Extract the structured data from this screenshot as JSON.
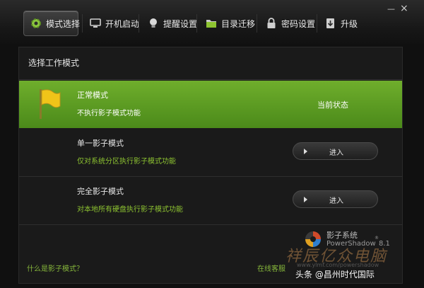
{
  "tabs": [
    {
      "label": "模式选择",
      "icon": "gear-icon"
    },
    {
      "label": "开机启动",
      "icon": "monitor-icon"
    },
    {
      "label": "提醒设置",
      "icon": "lightbulb-icon"
    },
    {
      "label": "目录迁移",
      "icon": "folder-icon"
    },
    {
      "label": "密码设置",
      "icon": "lock-icon"
    },
    {
      "label": "升级",
      "icon": "upgrade-icon"
    }
  ],
  "window_controls": {
    "minimize": "—",
    "close": "×"
  },
  "panel": {
    "title": "选择工作模式",
    "modes": [
      {
        "name": "正常模式",
        "desc": "不执行影子模式功能",
        "status": "当前状态"
      },
      {
        "name": "单一影子模式",
        "desc": "仅对系统分区执行影子模式功能",
        "button": "进入"
      },
      {
        "name": "完全影子模式",
        "desc": "对本地所有硬盘执行影子模式功能",
        "button": "进入"
      }
    ]
  },
  "logo": {
    "name": "影子系统",
    "product": "PowerShadow",
    "version": "8.1"
  },
  "footer": {
    "help_link": "什么是影子模式？",
    "service_link": "在线客服",
    "url": "www.ylmf.com/powershadow",
    "watermark": "祥辰亿众电脑",
    "credit": "头条 @昌州时代国际"
  },
  "colors": {
    "accent_green": "#5c9b22",
    "link_green": "#86b73b",
    "desc_green": "#8ec431"
  }
}
